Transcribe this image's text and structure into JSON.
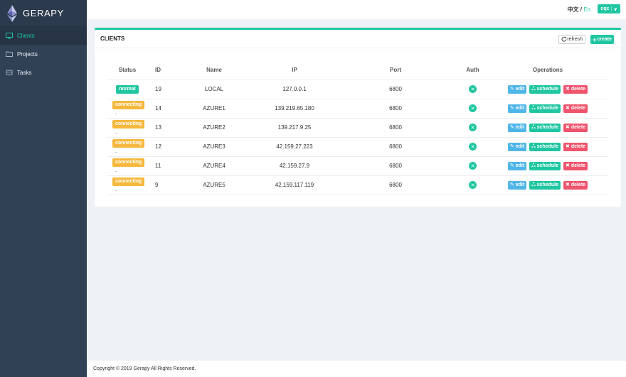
{
  "app": {
    "logo_text": "GERAPY"
  },
  "sidebar": {
    "items": [
      {
        "label": "Clients",
        "icon": "monitor-icon",
        "active": true
      },
      {
        "label": "Projects",
        "icon": "folder-icon",
        "active": false
      },
      {
        "label": "Tasks",
        "icon": "tasks-icon",
        "active": false
      }
    ]
  },
  "topbar": {
    "lang_zh": "中文",
    "lang_sep": " / ",
    "lang_en": "En",
    "user": "cqc",
    "user_caret": "∨"
  },
  "panel": {
    "title": "CLIENTS",
    "refresh_label": "refresh",
    "create_label": "create"
  },
  "table": {
    "headers": {
      "status": "Status",
      "id": "ID",
      "name": "Name",
      "ip": "IP",
      "port": "Port",
      "auth": "Auth",
      "operations": "Operations"
    },
    "rows": [
      {
        "status": "normal",
        "id": "19",
        "name": "LOCAL",
        "ip": "127.0.0.1",
        "port": "6800"
      },
      {
        "status": "connecting",
        "id": "14",
        "name": "AZURE1",
        "ip": "139.219.65.180",
        "port": "6800"
      },
      {
        "status": "connecting",
        "id": "13",
        "name": "AZURE2",
        "ip": "139.217.9.25",
        "port": "6800"
      },
      {
        "status": "connecting",
        "id": "12",
        "name": "AZURE3",
        "ip": "42.159.27.223",
        "port": "6800"
      },
      {
        "status": "connecting",
        "id": "11",
        "name": "AZURE4",
        "ip": "42.159.27.9",
        "port": "6800"
      },
      {
        "status": "connecting",
        "id": "9",
        "name": "AZURE5",
        "ip": "42.159.117.119",
        "port": "6800"
      }
    ],
    "ops": {
      "edit": "edit",
      "schedule": "schedule",
      "delete": "delete"
    },
    "connecting_suffix": "."
  },
  "footer": {
    "text": "Copyright © 2019 Gerapy All Rights Reserved."
  },
  "colors": {
    "accent": "#20c6a1",
    "warning": "#f5b83d",
    "danger": "#f0536c",
    "info": "#4fb6e8",
    "sidebar": "#304156"
  }
}
